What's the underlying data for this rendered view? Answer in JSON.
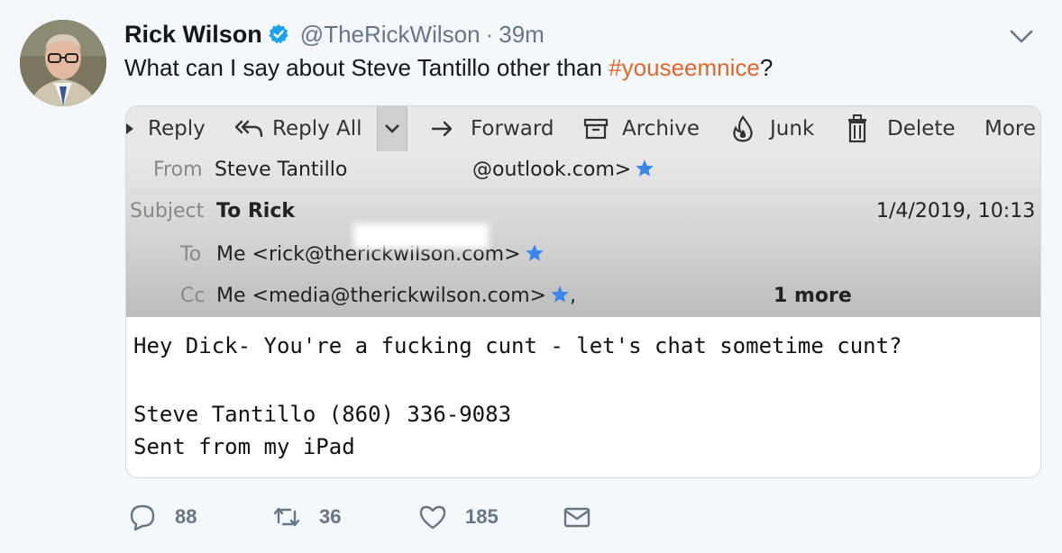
{
  "tweet": {
    "author_name": "Rick Wilson",
    "handle": "@TheRickWilson",
    "separator": "·",
    "time": "39m",
    "text_prefix": "What can I say about Steve Tantillo other than ",
    "hashtag": "#youseemnice",
    "text_suffix": "?",
    "hashtag_color": "#e0662a"
  },
  "email": {
    "toolbar": {
      "reply": "Reply",
      "reply_all": "Reply All",
      "forward": "Forward",
      "archive": "Archive",
      "junk": "Junk",
      "delete": "Delete",
      "more": "More"
    },
    "from_label": "From",
    "from_name": "Steve Tantillo",
    "from_address_visible": "@outlook.com>",
    "subject_label": "Subject",
    "subject": "To Rick",
    "date": "1/4/2019, 10:13",
    "to_label": "To",
    "to_value": "Me <rick@therickwilson.com>",
    "cc_label": "Cc",
    "cc_value": "Me <media@therickwilson.com>",
    "cc_suffix": ",",
    "more_recipients": "1 more",
    "body_line1": "Hey Dick- You're a fucking cunt - let's chat sometime cunt?",
    "body_line2": "Steve Tantillo (860) 336-9083",
    "body_line3": "Sent from my iPad"
  },
  "actions": {
    "replies": "88",
    "retweets": "36",
    "likes": "185"
  },
  "icons": {
    "verified": "verified-badge-icon",
    "chevron": "chevron-down-icon",
    "reply": "reply-icon",
    "retweet": "retweet-icon",
    "like": "heart-icon",
    "dm": "envelope-icon"
  }
}
